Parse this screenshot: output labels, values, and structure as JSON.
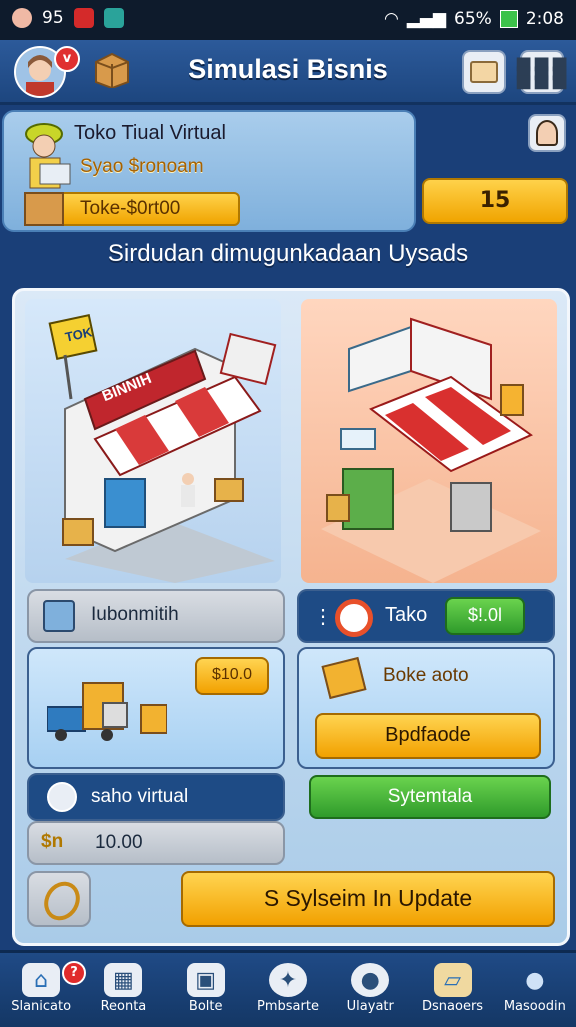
{
  "status_bar": {
    "notif_count": "95",
    "battery": "65%",
    "time": "2:08"
  },
  "header": {
    "title": "Simulasi Bisnis",
    "avatar_badge": "v"
  },
  "info": {
    "name": "Toko Tiual Virtual",
    "sub": "Syao $ronoam",
    "bar_label": "Toke-$0rt00",
    "coins": "15"
  },
  "heading": "Sirdudan dimugunkadaan Uysads",
  "shop1": {
    "sign": "TOK",
    "awning_text": "BINNIH"
  },
  "row1": {
    "left_label": "Iubonmitih",
    "right_label": "Tako",
    "right_price": "$!.0l"
  },
  "row2": {
    "price": "$10.0",
    "card_label": "Boke aoto",
    "card_button": "Bpdfaode"
  },
  "row3": {
    "left_label": "saho virtual",
    "right_button": "Sytemtala"
  },
  "row4": {
    "icon_label": "$n",
    "value": "10.00"
  },
  "row5": {
    "button": "S Sylseim In Update"
  },
  "nav": {
    "items": [
      {
        "label": "Slanicato",
        "icon": "home-icon",
        "badge": "?"
      },
      {
        "label": "Reonta",
        "icon": "dashboard-icon"
      },
      {
        "label": "Bolte",
        "icon": "box-icon"
      },
      {
        "label": "Pmbsarte",
        "icon": "compass-icon"
      },
      {
        "label": "Ulayatr",
        "icon": "location-icon"
      },
      {
        "label": "Dsnaoers",
        "icon": "map-icon"
      },
      {
        "label": "Masoodin",
        "icon": "profile-icon"
      }
    ]
  },
  "colors": {
    "accent_yellow": "#f2a100",
    "accent_green": "#2f9b2b",
    "header_blue": "#1d467f"
  }
}
